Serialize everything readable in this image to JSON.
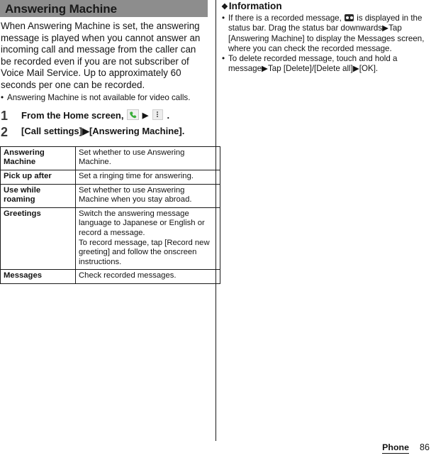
{
  "document": {
    "section_title": "Answering Machine",
    "chapter": "Phone",
    "page_number": "86"
  },
  "left_column": {
    "intro_paragraph": "When Answering Machine is set, the answering message is played when you cannot answer an incoming call and message from the caller can be recorded even if you are not subscriber of Voice Mail Service. Up to approximately 60 seconds per one can be recorded.",
    "notes": [
      "Answering Machine is not available for video calls."
    ],
    "steps": [
      {
        "number": "1",
        "text_before": "From the Home screen,",
        "icon_1": "phone-icon",
        "separator": "▶",
        "icon_2": "overflow-menu-icon",
        "text_after": "."
      },
      {
        "number": "2",
        "text": "[Call settings]▶[Answering Machine]."
      }
    ],
    "settings_table": {
      "rows": [
        {
          "key": "Answering Machine",
          "value": "Set whether to use Answering Machine."
        },
        {
          "key": "Pick up after",
          "value": "Set a ringing time for answering."
        },
        {
          "key": "Use while roaming",
          "value": "Set whether to use Answering Machine when you stay abroad."
        },
        {
          "key": "Greetings",
          "value": "Switch the answering message language to Japanese or English or record a message.\nTo record message, tap [Record new greeting] and follow the onscreen instructions."
        },
        {
          "key": "Messages",
          "value": "Check recorded messages."
        }
      ]
    }
  },
  "right_column": {
    "info_heading": "Information",
    "info_marker": "❖",
    "notes": [
      {
        "part_1": "If there is a recorded message,",
        "icon": "voicemail-cassette-icon",
        "part_2": "is displayed in the status bar. Drag the status bar downwards▶Tap [Answering Machine] to display the Messages screen, where you can check the recorded message."
      },
      {
        "text": "To delete recorded message, touch and hold a message▶Tap [Delete]/[Delete all]▶[OK]."
      }
    ]
  },
  "colors": {
    "header_bar": "#8d8d8d",
    "text": "#141414",
    "phone_icon_green": "#3aae3a",
    "rule": "#1a1a1a"
  }
}
